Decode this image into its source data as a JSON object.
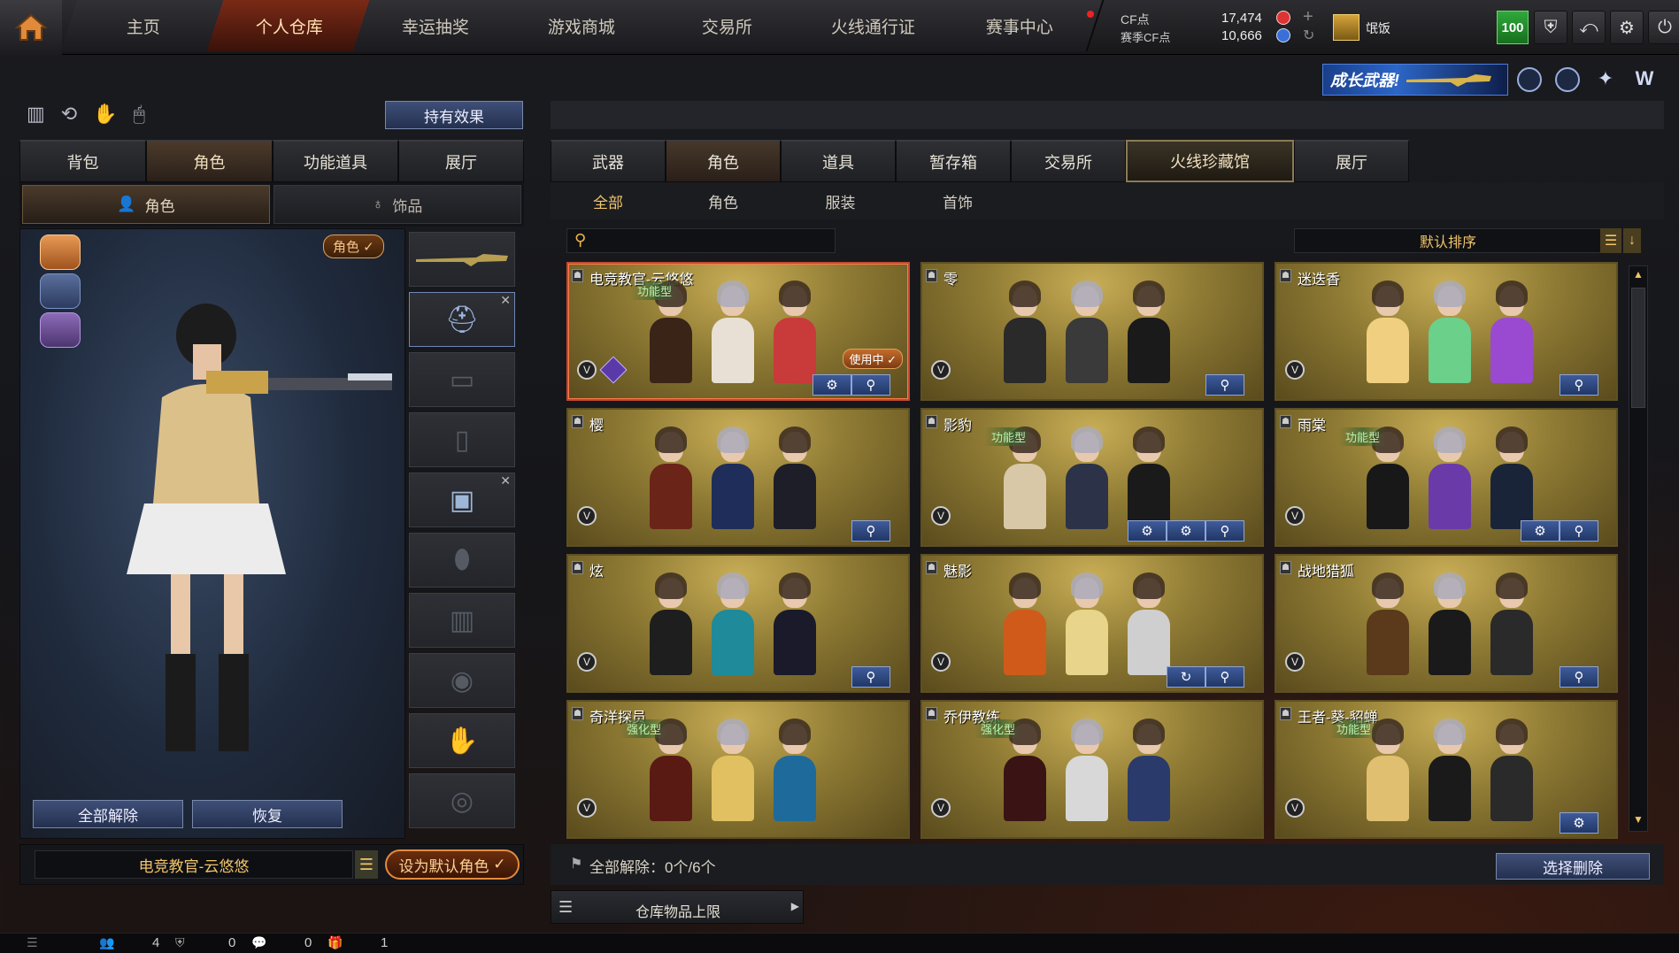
{
  "topnav": {
    "tabs": [
      "主页",
      "个人仓库",
      "幸运抽奖",
      "游戏商城",
      "交易所",
      "火线通行证",
      "赛事中心"
    ],
    "active_tab": "个人仓库",
    "cf_label": "CF点",
    "cf_value": "17,474",
    "season_cf_label": "赛季CF点",
    "season_cf_value": "10,666",
    "username": "氓饭",
    "level": "100"
  },
  "promo": {
    "banner_text": "成长武器!"
  },
  "left": {
    "hold_effect_label": "持有效果",
    "tabs": [
      "背包",
      "角色",
      "功能道具",
      "展厅"
    ],
    "active_tab": "角色",
    "subtabs": [
      "角色",
      "饰品"
    ],
    "active_subtab": "角色",
    "role_badge": "角色",
    "unequip_all": "全部解除",
    "restore": "恢复",
    "current_character": "电竞教官-云悠悠",
    "set_default": "设为默认角色"
  },
  "right": {
    "tabs": [
      "武器",
      "角色",
      "道具",
      "暂存箱",
      "交易所",
      "火线珍藏馆",
      "展厅"
    ],
    "active_tab": "火线珍藏馆",
    "filters": [
      "全部",
      "角色",
      "服装",
      "首饰"
    ],
    "active_filter": "全部",
    "search_placeholder": "",
    "sort_label": "默认排序",
    "cards": [
      {
        "name": "电竞教官-云悠悠",
        "type": "功能型",
        "in_use": "使用中",
        "selected": true
      },
      {
        "name": "零",
        "type": "",
        "in_use": "",
        "selected": false
      },
      {
        "name": "迷迭香",
        "type": "",
        "in_use": "",
        "selected": false
      },
      {
        "name": "樱",
        "type": "",
        "in_use": "",
        "selected": false
      },
      {
        "name": "影豹",
        "type": "功能型",
        "in_use": "",
        "selected": false
      },
      {
        "name": "雨棠",
        "type": "功能型",
        "in_use": "",
        "selected": false
      },
      {
        "name": "炫",
        "type": "",
        "in_use": "",
        "selected": false
      },
      {
        "name": "魅影",
        "type": "",
        "in_use": "",
        "selected": false
      },
      {
        "name": "战地猎狐",
        "type": "",
        "in_use": "",
        "selected": false
      },
      {
        "name": "奇洋探员",
        "type": "强化型",
        "in_use": "",
        "selected": false
      },
      {
        "name": "乔伊教练",
        "type": "强化型",
        "in_use": "",
        "selected": false
      },
      {
        "name": "王者-葵-貂蝉",
        "type": "功能型",
        "in_use": "",
        "selected": false
      }
    ],
    "unequip_summary": "全部解除：0个/6个",
    "select_delete": "选择删除",
    "storage_limit": "仓库物品上限"
  },
  "statusbar": {
    "friends": "4",
    "shield": "0",
    "messages": "0",
    "gifts": "1"
  }
}
